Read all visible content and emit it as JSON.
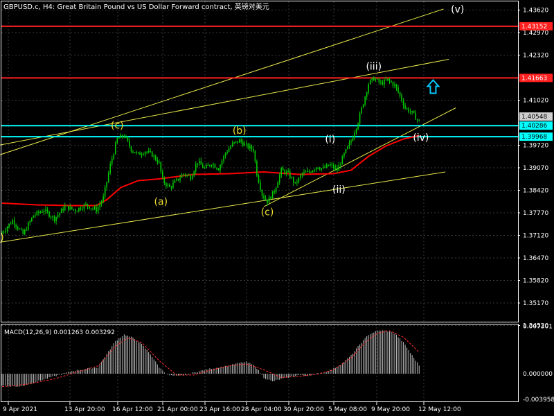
{
  "header": {
    "title": "GBPUSD.c, H4:  Great Britain Pound vs US Dollar Forward contract, 英镑对美元"
  },
  "colors": {
    "background": "#000000",
    "frame": "#ffffff",
    "grid": "#3a3a3a",
    "candle": "#00cc00",
    "moving_average": "#ff0000",
    "resistance": "#ff2020",
    "support": "#00ffff",
    "channel": "#e8e84a",
    "wave_yellow": "#f0e030",
    "wave_white": "#ffffff",
    "arrow": "#00ccff",
    "macd_hist": "#c0c0c0",
    "macd_signal": "#ff3030"
  },
  "chart_data": [
    {
      "type": "candlestick",
      "symbol": "GBPUSD.c",
      "timeframe": "H4",
      "ylim": [
        1.349,
        1.4385
      ],
      "y_ticks": [
        "1.43620",
        "1.42970",
        "1.42320",
        "1.41020",
        "1.39720",
        "1.39070",
        "1.38420",
        "1.37770",
        "1.37120",
        "1.36470",
        "1.35820",
        "1.35170",
        "1.34520"
      ],
      "x_ticks": [
        "9 Apr 2021",
        "13 Apr 20:00",
        "16 Apr 12:00",
        "21 Apr 00:00",
        "23 Apr 16:00",
        "28 Apr 04:00",
        "30 Apr 20:00",
        "5 May 08:00",
        "9 May 20:00",
        "12 May 12:00"
      ],
      "close_path": [
        [
          0,
          1.372
        ],
        [
          6,
          1.3755
        ],
        [
          12,
          1.3715
        ],
        [
          18,
          1.377
        ],
        [
          24,
          1.3785
        ],
        [
          30,
          1.376
        ],
        [
          36,
          1.3795
        ],
        [
          42,
          1.3785
        ],
        [
          48,
          1.38
        ],
        [
          54,
          1.3785
        ],
        [
          58,
          1.382
        ],
        [
          62,
          1.3915
        ],
        [
          66,
          1.399
        ],
        [
          70,
          1.4
        ],
        [
          74,
          1.396
        ],
        [
          78,
          1.3945
        ],
        [
          82,
          1.3955
        ],
        [
          86,
          1.3945
        ],
        [
          90,
          1.392
        ],
        [
          92,
          1.387
        ],
        [
          96,
          1.385
        ],
        [
          100,
          1.387
        ],
        [
          104,
          1.389
        ],
        [
          108,
          1.388
        ],
        [
          112,
          1.3925
        ],
        [
          116,
          1.3905
        ],
        [
          120,
          1.392
        ],
        [
          124,
          1.3905
        ],
        [
          128,
          1.395
        ],
        [
          132,
          1.3975
        ],
        [
          136,
          1.3985
        ],
        [
          140,
          1.397
        ],
        [
          144,
          1.396
        ],
        [
          146,
          1.389
        ],
        [
          149,
          1.383
        ],
        [
          152,
          1.381
        ],
        [
          156,
          1.384
        ],
        [
          160,
          1.39
        ],
        [
          164,
          1.389
        ],
        [
          168,
          1.386
        ],
        [
          172,
          1.389
        ],
        [
          176,
          1.3895
        ],
        [
          180,
          1.391
        ],
        [
          184,
          1.3905
        ],
        [
          188,
          1.3915
        ],
        [
          192,
          1.39
        ],
        [
          196,
          1.3945
        ],
        [
          200,
          1.3985
        ],
        [
          204,
          1.404
        ],
        [
          207,
          1.4095
        ],
        [
          210,
          1.415
        ],
        [
          213,
          1.4165
        ],
        [
          217,
          1.415
        ],
        [
          221,
          1.416
        ],
        [
          225,
          1.4145
        ],
        [
          228,
          1.4115
        ],
        [
          231,
          1.408
        ],
        [
          235,
          1.4065
        ],
        [
          239,
          1.404
        ]
      ],
      "moving_average": [
        [
          0,
          1.3805
        ],
        [
          20,
          1.38
        ],
        [
          40,
          1.3798
        ],
        [
          54,
          1.3798
        ],
        [
          60,
          1.3815
        ],
        [
          68,
          1.385
        ],
        [
          78,
          1.387
        ],
        [
          90,
          1.3875
        ],
        [
          110,
          1.3888
        ],
        [
          130,
          1.389
        ],
        [
          150,
          1.3895
        ],
        [
          170,
          1.3888
        ],
        [
          190,
          1.389
        ],
        [
          200,
          1.39
        ],
        [
          210,
          1.394
        ],
        [
          220,
          1.397
        ],
        [
          230,
          1.399
        ],
        [
          239,
          1.4
        ]
      ],
      "horizontal_lines": [
        {
          "price": "1.43152",
          "kind": "resistance"
        },
        {
          "price": "1.41663",
          "kind": "resistance"
        },
        {
          "price": "1.40286",
          "kind": "support"
        },
        {
          "price": "1.39968",
          "kind": "support"
        }
      ],
      "current_price": "1.40548",
      "trend_lines": [
        {
          "from": [
            -4,
            1.369
          ],
          "to": [
            254,
            1.3895
          ],
          "kind": "channel"
        },
        {
          "from": [
            -4,
            1.394
          ],
          "to": [
            253,
            1.4365
          ],
          "kind": "channel"
        },
        {
          "from": [
            -4,
            1.397
          ],
          "to": [
            256,
            1.422
          ],
          "kind": "channel"
        },
        {
          "from": [
            150,
            1.3795
          ],
          "to": [
            260,
            1.408
          ],
          "kind": "channel"
        }
      ],
      "wave_labels": [
        {
          "text": "(c)",
          "x": 66,
          "price": 1.402,
          "color": "yellow"
        },
        {
          "text": "(a)",
          "x": 91,
          "price": 1.38,
          "color": "yellow"
        },
        {
          "text": "(b)",
          "x": 136,
          "price": 1.4005,
          "color": "yellow"
        },
        {
          "text": "(c)",
          "x": 152,
          "price": 1.377,
          "color": "yellow"
        },
        {
          "text": "(i)",
          "x": 188,
          "price": 1.398,
          "color": "white"
        },
        {
          "text": "(ii)",
          "x": 193,
          "price": 1.3835,
          "color": "white"
        },
        {
          "text": "(iii)",
          "x": 213,
          "price": 1.419,
          "color": "white"
        },
        {
          "text": "(iv)",
          "x": 240,
          "price": 1.3985,
          "color": "white"
        },
        {
          "text": "(v)",
          "x": 261,
          "price": 1.4355,
          "color": "white"
        },
        {
          "text": ")",
          "x": 0,
          "price": 1.3697,
          "color": "yellow"
        }
      ],
      "arrow": {
        "direction": "up",
        "x": 247,
        "price": 1.414
      }
    },
    {
      "type": "bar",
      "indicator": "MACD(12,26,9)",
      "title": "MACD(12,26,9) 0.001263 0.003292",
      "ylim": [
        -0.0042,
        0.0078
      ],
      "y_ticks": [
        "0.007301",
        "0.000000",
        "-0.003958"
      ],
      "histogram": [
        [
          0,
          -0.0018
        ],
        [
          10,
          -0.002
        ],
        [
          20,
          -0.0012
        ],
        [
          30,
          -0.0004
        ],
        [
          40,
          0.0004
        ],
        [
          50,
          0.0008
        ],
        [
          55,
          0.001
        ],
        [
          60,
          0.003
        ],
        [
          65,
          0.005
        ],
        [
          70,
          0.006
        ],
        [
          75,
          0.0055
        ],
        [
          80,
          0.0045
        ],
        [
          85,
          0.003
        ],
        [
          90,
          0.001
        ],
        [
          95,
          -0.0002
        ],
        [
          100,
          -0.0004
        ],
        [
          105,
          -0.0002
        ],
        [
          110,
          0.0002
        ],
        [
          115,
          0.0005
        ],
        [
          120,
          0.0008
        ],
        [
          125,
          0.001
        ],
        [
          130,
          0.0012
        ],
        [
          135,
          0.0016
        ],
        [
          140,
          0.0018
        ],
        [
          145,
          0.0012
        ],
        [
          150,
          -0.0006
        ],
        [
          155,
          -0.0012
        ],
        [
          160,
          -0.0008
        ],
        [
          165,
          -0.0005
        ],
        [
          170,
          -0.0002
        ],
        [
          175,
          -0.0003
        ],
        [
          180,
          0.0
        ],
        [
          185,
          0.0002
        ],
        [
          190,
          0.0008
        ],
        [
          195,
          0.0016
        ],
        [
          200,
          0.0028
        ],
        [
          205,
          0.0045
        ],
        [
          210,
          0.006
        ],
        [
          215,
          0.0066
        ],
        [
          220,
          0.0066
        ],
        [
          225,
          0.0062
        ],
        [
          230,
          0.0048
        ],
        [
          235,
          0.0028
        ],
        [
          239,
          0.0013
        ]
      ],
      "signal": [
        [
          0,
          -0.002
        ],
        [
          15,
          -0.0016
        ],
        [
          30,
          -0.0008
        ],
        [
          45,
          0.0004
        ],
        [
          55,
          0.0012
        ],
        [
          65,
          0.0042
        ],
        [
          72,
          0.0055
        ],
        [
          80,
          0.0048
        ],
        [
          90,
          0.002
        ],
        [
          100,
          -0.0002
        ],
        [
          110,
          -0.0002
        ],
        [
          120,
          0.0006
        ],
        [
          130,
          0.0012
        ],
        [
          140,
          0.0015
        ],
        [
          150,
          0.0006
        ],
        [
          160,
          -0.0006
        ],
        [
          170,
          -0.0004
        ],
        [
          180,
          -0.0001
        ],
        [
          190,
          0.0006
        ],
        [
          200,
          0.0024
        ],
        [
          208,
          0.0048
        ],
        [
          215,
          0.0062
        ],
        [
          222,
          0.0066
        ],
        [
          230,
          0.0056
        ],
        [
          239,
          0.0033
        ]
      ]
    }
  ]
}
